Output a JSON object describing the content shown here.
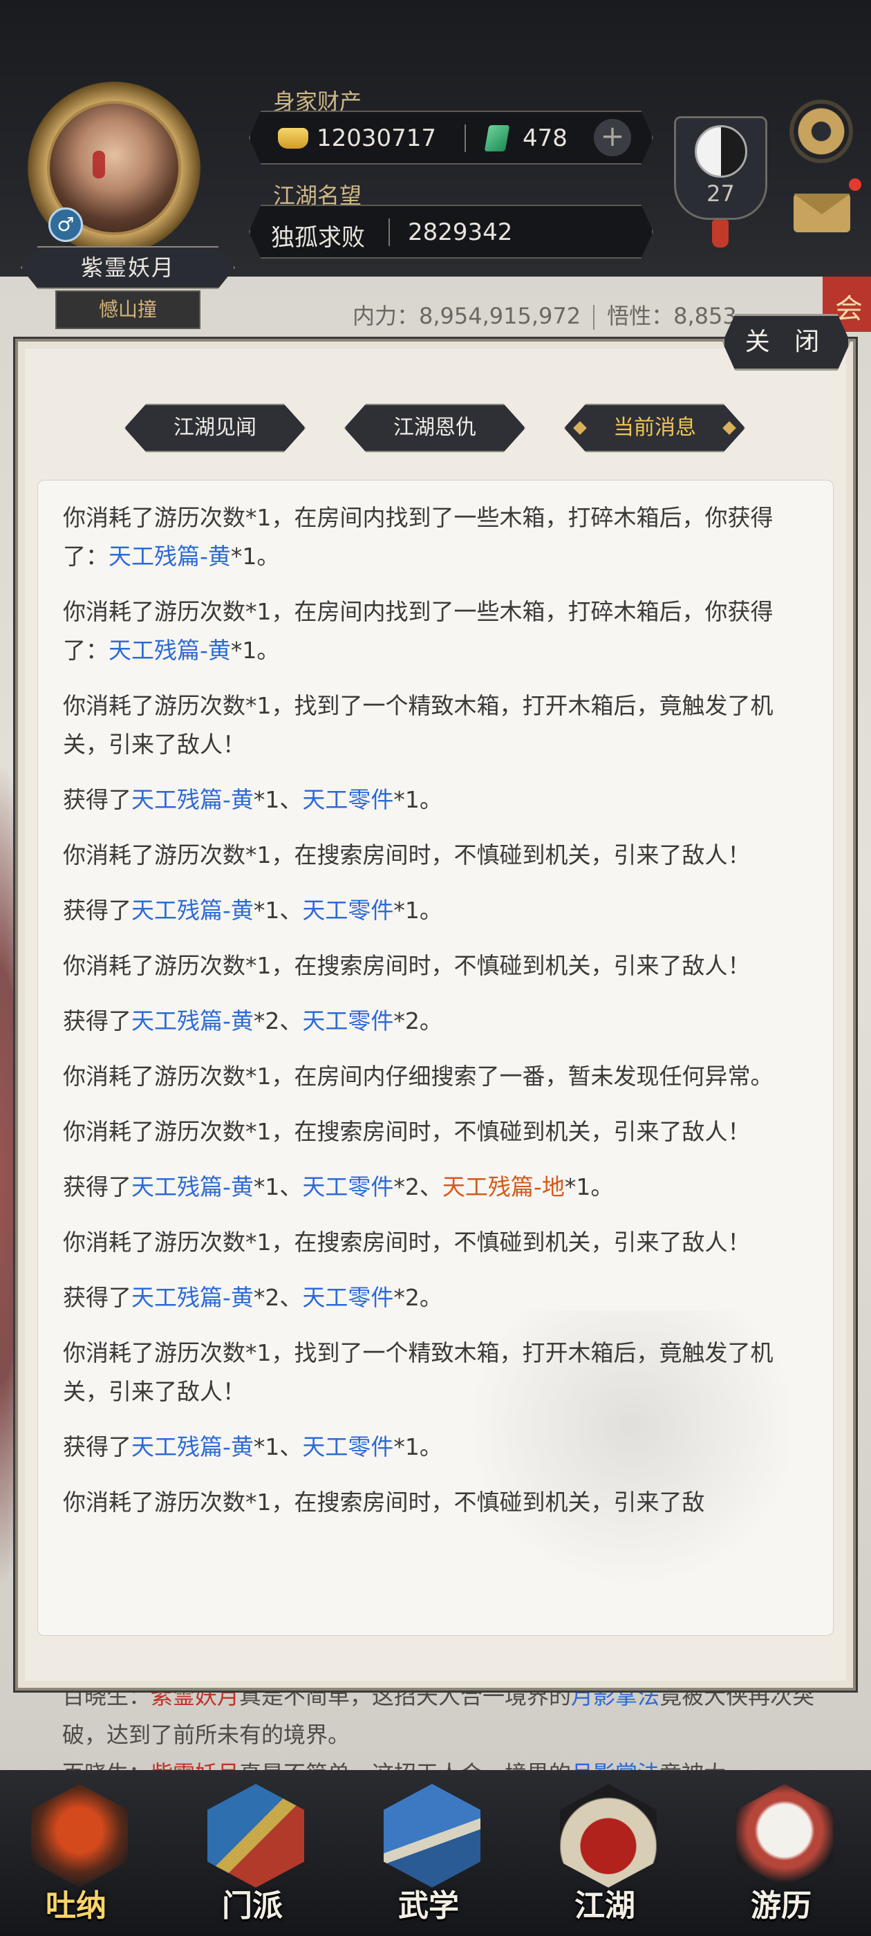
{
  "header": {
    "wealth_label": "身家财产",
    "gold": "12030717",
    "jade": "478",
    "fame_label": "江湖名望",
    "rank_title": "独孤求败",
    "fame_value": "2829342",
    "level": "27",
    "player_name": "紫霊妖月",
    "player_title": "憾山撞",
    "gender_symbol": "♂",
    "plus": "+"
  },
  "info_strip": {
    "neili": "内力：8,954,915,972",
    "wuxing": "悟性：8,853,"
  },
  "corner_tag": "会",
  "dialog": {
    "close_label": "关 闭",
    "tabs": [
      "江湖见闻",
      "江湖恩仇",
      "当前消息"
    ],
    "active_tab": 2
  },
  "log": {
    "e1": {
      "a": "你消耗了游历次数*1，在房间内找到了一些木箱，打碎木箱后，你获得了：",
      "i1": "天工残篇-黄",
      "b": "*1。"
    },
    "e2": {
      "a": "你消耗了游历次数*1，在房间内找到了一些木箱，打碎木箱后，你获得了：",
      "i1": "天工残篇-黄",
      "b": "*1。"
    },
    "e3": {
      "a": "你消耗了游历次数*1，找到了一个精致木箱，打开木箱后，竟触发了机关，引来了敌人！"
    },
    "e4": {
      "a": "获得了",
      "i1": "天工残篇-黄",
      "b": "*1、",
      "i2": "天工零件",
      "c": "*1。"
    },
    "e5": {
      "a": "你消耗了游历次数*1，在搜索房间时，不慎碰到机关，引来了敌人！"
    },
    "e6": {
      "a": "获得了",
      "i1": "天工残篇-黄",
      "b": "*1、",
      "i2": "天工零件",
      "c": "*1。"
    },
    "e7": {
      "a": "你消耗了游历次数*1，在搜索房间时，不慎碰到机关，引来了敌人！"
    },
    "e8": {
      "a": "获得了",
      "i1": "天工残篇-黄",
      "b": "*2、",
      "i2": "天工零件",
      "c": "*2。"
    },
    "e9": {
      "a": "你消耗了游历次数*1，在房间内仔细搜索了一番，暂未发现任何异常。"
    },
    "e10": {
      "a": "你消耗了游历次数*1，在搜索房间时，不慎碰到机关，引来了敌人！"
    },
    "e11": {
      "a": "获得了",
      "i1": "天工残篇-黄",
      "b": "*1、",
      "i2": "天工零件",
      "c": "*2、",
      "i3": "天工残篇-地",
      "d": "*1。"
    },
    "e12": {
      "a": "你消耗了游历次数*1，在搜索房间时，不慎碰到机关，引来了敌人！"
    },
    "e13": {
      "a": "获得了",
      "i1": "天工残篇-黄",
      "b": "*2、",
      "i2": "天工零件",
      "c": "*2。"
    },
    "e14": {
      "a": "你消耗了游历次数*1，找到了一个精致木箱，打开木箱后，竟触发了机关，引来了敌人！"
    },
    "e15": {
      "a": "获得了",
      "i1": "天工残篇-黄",
      "b": "*1、",
      "i2": "天工零件",
      "c": "*1。"
    },
    "e16": {
      "a": "你消耗了游历次数*1，在搜索房间时，不慎碰到机关，引来了敌"
    }
  },
  "chat": {
    "l1_a": "百晓生：",
    "l1_name": "紫霊妖月",
    "l1_b": "真是不简单，这招天人合一境界的",
    "l1_skill": "月影掌法",
    "l1_c": "竟被大侠再次突破，达到了前所未有的境界。",
    "l2_a": "百晓生：",
    "l2_name": "紫霊妖月",
    "l2_b": "真是不简单，这招天人合一境界的",
    "l2_skill": "月影掌法",
    "l2_c": "竟被大"
  },
  "nav": [
    "吐纳",
    "门派",
    "武学",
    "江湖",
    "游历"
  ],
  "colors": {
    "item_blue": "#2c6ad6",
    "item_orange": "#d35a1a",
    "active_tab": "#f0c556"
  }
}
